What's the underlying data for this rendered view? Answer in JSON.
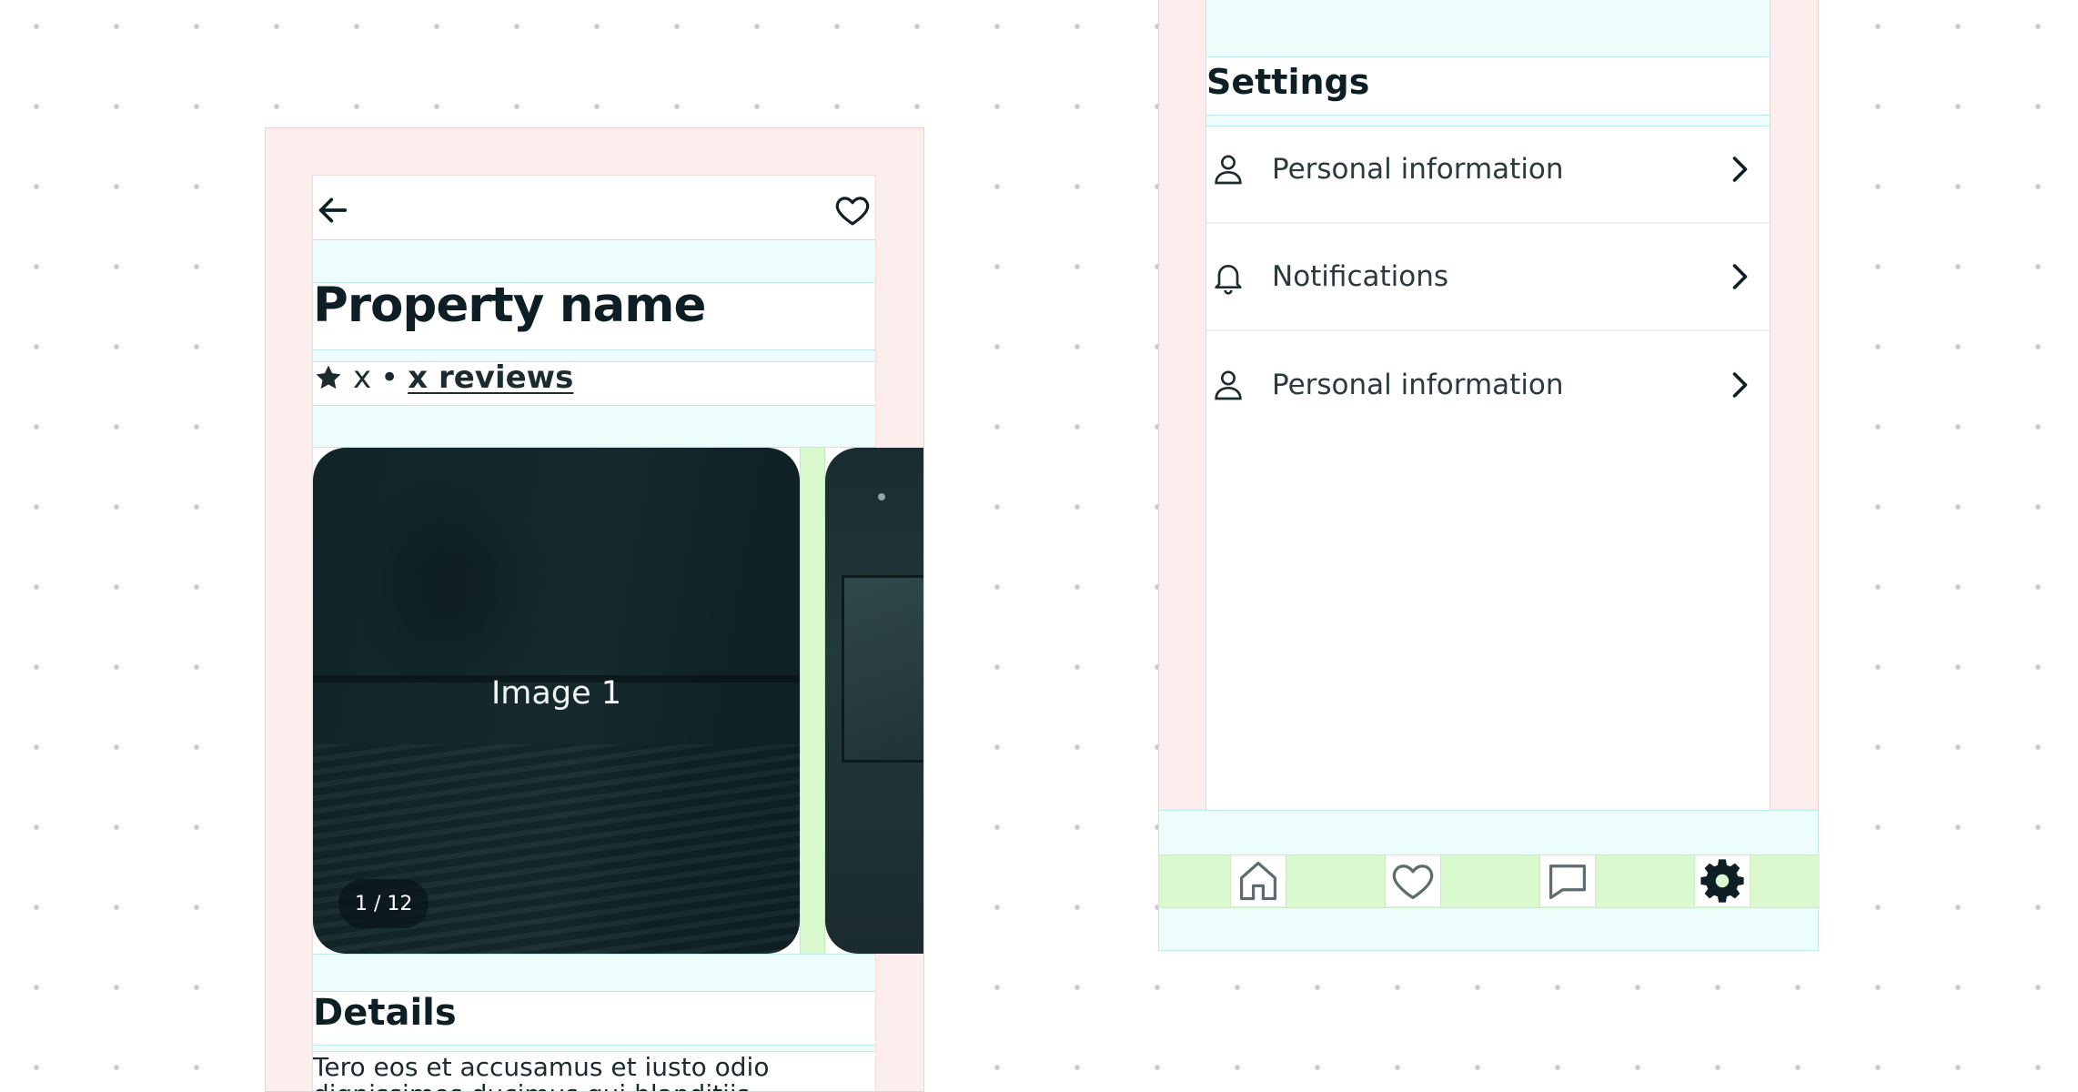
{
  "property_screen": {
    "title": "Property name",
    "rating": {
      "value": "x",
      "separator": "•",
      "reviews_link": "x reviews"
    },
    "carousel": {
      "image_label": "Image 1",
      "counter": "1 / 12",
      "current_index": 1,
      "total_images": 12
    },
    "details": {
      "heading": "Details",
      "body": "Tero eos et accusamus et iusto odio dignissimos ducimus qui blanditiis"
    },
    "icons": {
      "back": "arrow-left-icon",
      "favorite": "heart-icon",
      "rating": "star-icon"
    }
  },
  "settings_screen": {
    "title": "Settings",
    "items": [
      {
        "label": "Personal information",
        "icon": "user-icon"
      },
      {
        "label": "Notifications",
        "icon": "bell-icon"
      },
      {
        "label": "Personal information",
        "icon": "user-icon"
      }
    ],
    "bottom_nav": [
      {
        "icon": "home-icon",
        "active": false
      },
      {
        "icon": "heart-icon",
        "active": false
      },
      {
        "icon": "chat-icon",
        "active": false
      },
      {
        "icon": "gear-icon",
        "active": true
      }
    ]
  },
  "colors": {
    "text_primary": "#0d1f24",
    "spacing_highlight": "#ecfdfb",
    "padding_highlight": "#fdeeee",
    "gap_highlight": "#dbf9cf"
  }
}
